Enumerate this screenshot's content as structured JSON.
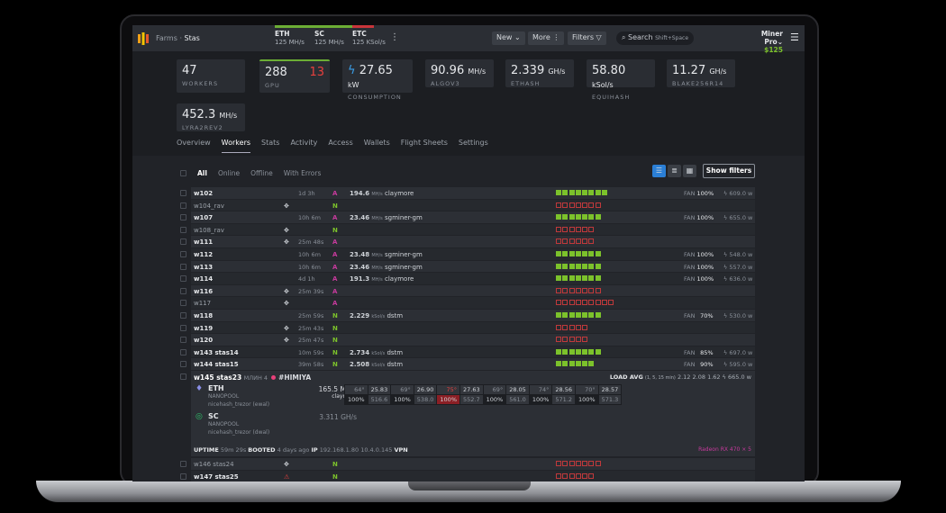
{
  "header": {
    "breadcrumb_root": "Farms",
    "breadcrumb_sep": "·",
    "breadcrumb_current": "Stas",
    "coins": [
      {
        "name": "ETH",
        "rate": "125 MH/s",
        "color": "#6cae35"
      },
      {
        "name": "SC",
        "rate": "125 MH/s",
        "color": "#6cae35"
      },
      {
        "name": "ETC",
        "rate": "125 KSol/s",
        "color": "#c9353a"
      }
    ],
    "new_label": "New",
    "more_label": "More",
    "filters_label": "Filters",
    "search_placeholder": "Search",
    "search_hint": "Shift+Space",
    "account": "Miner Pro",
    "balance": "$125"
  },
  "stats": [
    {
      "value": "47",
      "unit": "",
      "label": "WORKERS"
    },
    {
      "value": "288",
      "extra": "13",
      "label": "GPU"
    },
    {
      "value": "27.65",
      "unit": "kW",
      "label": "CONSUMPTION"
    },
    {
      "value": "90.96",
      "unit": "MH/s",
      "label": "ALGOV3"
    },
    {
      "value": "2.339",
      "unit": "GH/s",
      "label": "ETHASH"
    },
    {
      "value": "58.80",
      "unit": "kSol/s",
      "label": "EQUIHASH"
    },
    {
      "value": "11.27",
      "unit": "GH/s",
      "label": "BLAKE256R14"
    },
    {
      "value": "452.3",
      "unit": "MH/s",
      "label": "LYRA2REV2"
    }
  ],
  "tabs": [
    "Overview",
    "Workers",
    "Stats",
    "Activity",
    "Access",
    "Wallets",
    "Flight Sheets",
    "Settings"
  ],
  "filters": [
    "All",
    "Online",
    "Offline",
    "With Errors"
  ],
  "show_filters": "Show filters",
  "colors": {
    "ok": "#7cc22b",
    "bad": "#c0393b",
    "A": "#c73a9d",
    "N": "#7cc22b"
  },
  "workers": [
    {
      "name": "w102",
      "uptime": "1d 3h",
      "status": "A",
      "hash": "194.6",
      "unit": "MH/s",
      "miner": "claymore",
      "gpus": 8,
      "ok": true,
      "fan": "100%",
      "power": "609.0 w"
    },
    {
      "name": "w104_rav",
      "dim": true,
      "icon": true,
      "status": "N",
      "gpus": 7
    },
    {
      "name": "w107",
      "uptime": "10h 6m",
      "status": "A",
      "hash": "23.46",
      "unit": "MH/s",
      "miner": "sgminer-gm",
      "gpus": 7,
      "ok": true,
      "fan": "100%",
      "power": "655.0 w"
    },
    {
      "name": "w108_rav",
      "dim": true,
      "icon": true,
      "status": "N",
      "gpus": 6
    },
    {
      "name": "w111",
      "icon": true,
      "uptime": "25m 48s",
      "status": "A",
      "gpus": 6
    },
    {
      "name": "w112",
      "uptime": "10h 6m",
      "status": "A",
      "hash": "23.48",
      "unit": "MH/s",
      "miner": "sgminer-gm",
      "gpus": 7,
      "ok": true,
      "fan": "100%",
      "power": "548.0 w"
    },
    {
      "name": "w113",
      "uptime": "10h 6m",
      "status": "A",
      "hash": "23.46",
      "unit": "MH/s",
      "miner": "sgminer-gm",
      "gpus": 7,
      "ok": true,
      "fan": "100%",
      "power": "557.0 w"
    },
    {
      "name": "w114",
      "uptime": "4d 1h",
      "status": "A",
      "hash": "191.3",
      "unit": "MH/s",
      "miner": "claymore",
      "gpus": 7,
      "ok": true,
      "fan": "100%",
      "power": "636.0 w"
    },
    {
      "name": "w116",
      "icon": true,
      "uptime": "25m 39s",
      "status": "A",
      "gpus": 7
    },
    {
      "name": "w117",
      "dim": true,
      "icon": true,
      "status": "A",
      "gpus": 9
    },
    {
      "name": "w118",
      "uptime": "25m 59s",
      "status": "N",
      "hash": "2.229",
      "unit": "kSol/s",
      "miner": "dstm",
      "gpus": 7,
      "ok": true,
      "fan": "70%",
      "power": "530.0 w"
    },
    {
      "name": "w119",
      "icon": true,
      "uptime": "25m 43s",
      "status": "N",
      "gpus": 5
    },
    {
      "name": "w120",
      "icon": true,
      "uptime": "25m 47s",
      "status": "N",
      "gpus": 5
    },
    {
      "name": "w143 stas14",
      "uptime": "10m 59s",
      "status": "N",
      "hash": "2.734",
      "unit": "kSol/s",
      "miner": "dstm",
      "gpus": 7,
      "ok": true,
      "fan": "85%",
      "power": "697.0 w"
    },
    {
      "name": "w144 stas15",
      "uptime": "39m 58s",
      "status": "N",
      "hash": "2.508",
      "unit": "kSol/s",
      "miner": "dstm",
      "gpus": 6,
      "ok": true,
      "fan": "90%",
      "power": "595.0 w"
    }
  ],
  "expanded": {
    "name": "w145 stas23",
    "sub": "МЛИН 4",
    "tag": "#HIMIYA",
    "load_label": "LOAD AVG",
    "load_hint": "(1, 5, 15 min)",
    "load": [
      "2.12",
      "2.08",
      "1.62"
    ],
    "power": "665.0 w",
    "coins": [
      {
        "name": "ETH",
        "pool": "NANOPOOL",
        "wallet": "nicehash_trezor (ewal)",
        "rate": "165.5 MH/s",
        "miner": "claymore"
      },
      {
        "name": "SC",
        "pool": "NANOPOOL",
        "wallet": "nicehash_trezor (dwal)",
        "rate": "3.311 GH/s",
        "miner": ""
      }
    ],
    "gpus": [
      {
        "temp": "64°",
        "hash": "25.83",
        "fan": "100%",
        "power": "516.6"
      },
      {
        "temp": "69°",
        "hash": "26.90",
        "fan": "100%",
        "power": "538.0"
      },
      {
        "temp": "75°",
        "hash": "27.63",
        "fan": "100%",
        "power": "552.7",
        "hot": true
      },
      {
        "temp": "69°",
        "hash": "28.05",
        "fan": "100%",
        "power": "561.0"
      },
      {
        "temp": "74°",
        "hash": "28.56",
        "fan": "100%",
        "power": "571.2"
      },
      {
        "temp": "70°",
        "hash": "28.57",
        "fan": "100%",
        "power": "571.3"
      }
    ],
    "uptime_label": "UPTIME",
    "uptime": "59m 29s",
    "booted_label": "BOOTED",
    "booted": "4 days ago",
    "ip_label": "IP",
    "ip": "192.168.1.80",
    "ip2": "10.4.0.145",
    "vpn": "VPN",
    "card": "Radeon RX 470 × 5"
  },
  "workers_after": [
    {
      "name": "w146 stas24",
      "dim": true,
      "icon": true,
      "status": "N",
      "gpus": 7
    },
    {
      "name": "w147 stas25",
      "warn": true,
      "status": "N",
      "gpus": 6
    }
  ]
}
